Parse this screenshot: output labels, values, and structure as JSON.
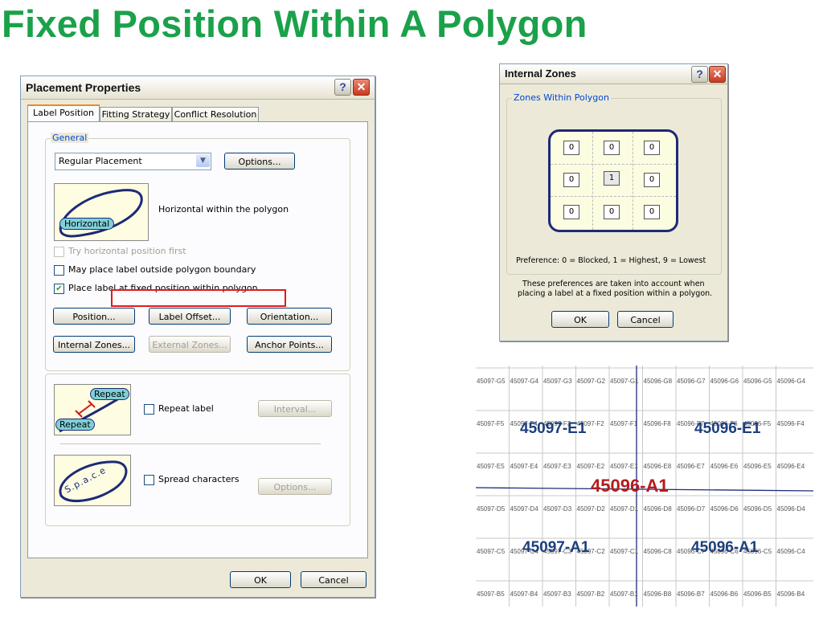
{
  "slide_title": "Fixed Position Within A Polygon",
  "placement_dialog": {
    "title": "Placement Properties",
    "tabs": [
      "Label Position",
      "Fitting Strategy",
      "Conflict Resolution"
    ],
    "general_group": "General",
    "placement_select": "Regular Placement",
    "options_button": "Options...",
    "horizontal_badge": "Horizontal",
    "horizontal_desc": "Horizontal within the polygon",
    "cb_try_horizontal": "Try horizontal position first",
    "cb_may_place": "May place label outside polygon boundary",
    "cb_fixed_position": "Place label at fixed position within polygon",
    "btn_position": "Position...",
    "btn_label_offset": "Label Offset...",
    "btn_orientation": "Orientation...",
    "btn_internal_zones": "Internal Zones...",
    "btn_external_zones": "External Zones...",
    "btn_anchor_points": "Anchor Points...",
    "repeat_badge_1": "Repeat",
    "repeat_badge_2": "Repeat",
    "cb_repeat_label": "Repeat label",
    "btn_interval": "Interval...",
    "space_letters": "S.p.a.c.e",
    "cb_spread_chars": "Spread characters",
    "btn_options2": "Options...",
    "btn_ok": "OK",
    "btn_cancel": "Cancel"
  },
  "zones_dialog": {
    "title": "Internal Zones",
    "group_label": "Zones Within Polygon",
    "grid": [
      [
        "0",
        "0",
        "0"
      ],
      [
        "0",
        "1",
        "0"
      ],
      [
        "0",
        "0",
        "0"
      ]
    ],
    "preference_text": "Preference:  0 = Blocked, 1 = Highest, 9 = Lowest",
    "note_line1": "These preferences are taken into account when",
    "note_line2": "placing a label at a fixed position within a polygon.",
    "btn_ok": "OK",
    "btn_cancel": "Cancel"
  },
  "map_grid": {
    "rows": [
      [
        "45097-G5",
        "45097-G4",
        "45097-G3",
        "45097-G2",
        "45097-G1",
        "45096-G8",
        "45096-G7",
        "45096-G6",
        "45096-G5",
        "45096-G4"
      ],
      [
        "45097-F5",
        "45097-F4",
        "45097-F3",
        "45097-F2",
        "45097-F1",
        "45096-F8",
        "45096-F7",
        "45096-F6",
        "45096-F5",
        "45096-F4"
      ],
      [
        "45097-E5",
        "45097-E4",
        "45097-E3",
        "45097-E2",
        "45097-E1",
        "45096-E8",
        "45096-E7",
        "45096-E6",
        "45096-E5",
        "45096-E4"
      ],
      [
        "45097-D5",
        "45097-D4",
        "45097-D3",
        "45097-D2",
        "45097-D1",
        "45096-D8",
        "45096-D7",
        "45096-D6",
        "45096-D5",
        "45096-D4"
      ],
      [
        "45097-C5",
        "45097-C4",
        "45097-C3",
        "45097-C2",
        "45097-C1",
        "45096-C8",
        "45096-C7",
        "45096-C6",
        "45096-C5",
        "45096-C4"
      ],
      [
        "45097-B5",
        "45097-B4",
        "45097-B3",
        "45097-B2",
        "45097-B1",
        "45096-B8",
        "45096-B7",
        "45096-B6",
        "45096-B5",
        "45096-B4"
      ]
    ],
    "big_labels": [
      "45097-E1",
      "45096-E1",
      "45096-A1",
      "45097-A1",
      "45096-A1"
    ],
    "big_label_colors": [
      "#1c3f7c",
      "#1c3f7c",
      "#b41c1c",
      "#1c3f7c",
      "#1c3f7c"
    ]
  }
}
